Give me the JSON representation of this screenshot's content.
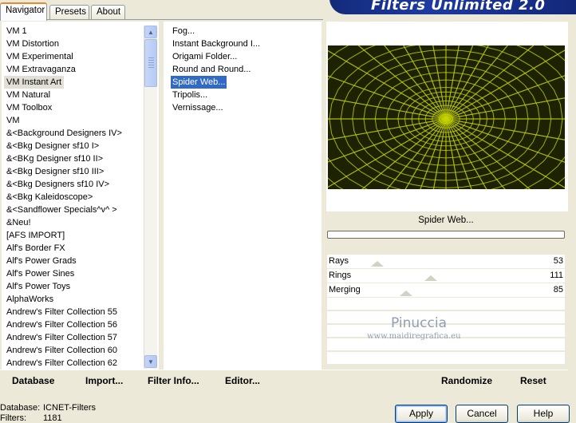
{
  "window_title": "Filters Unlimited 2.0",
  "tabs": [
    "Navigator",
    "Presets",
    "About"
  ],
  "categories": [
    "VM 1",
    "VM Distortion",
    "VM Experimental",
    "VM Extravaganza",
    "VM Instant Art",
    "VM Natural",
    "VM Toolbox",
    "VM",
    "&<Background Designers IV>",
    "&<Bkg Designer sf10 I>",
    "&<BKg Designer sf10 II>",
    "&<Bkg Designer sf10 III>",
    "&<Bkg Designers sf10 IV>",
    "&<Bkg Kaleidoscope>",
    "&<Sandflower Specials^v^ >",
    "&Neu!",
    "[AFS IMPORT]",
    "Alf's Border FX",
    "Alf's Power Grads",
    "Alf's Power Sines",
    "Alf's Power Toys",
    "AlphaWorks",
    "Andrew's Filter Collection 55",
    "Andrew's Filter Collection 56",
    "Andrew's Filter Collection 57",
    "Andrew's Filter Collection 60",
    "Andrew's Filter Collection 62"
  ],
  "selected_category": "VM Instant Art",
  "filters": [
    "Fog...",
    "Instant Background I...",
    "Origami Folder...",
    "Round and Round...",
    "Spider Web...",
    "Tripolis...",
    "Vernissage..."
  ],
  "selected_filter": "Spider Web...",
  "preview": {
    "filter_name": "Spider Web...",
    "colors": {
      "background": "#1d2202",
      "web": "#c8d400"
    }
  },
  "parameters": [
    {
      "label": "Rays",
      "value": "53"
    },
    {
      "label": "Rings",
      "value": "111"
    },
    {
      "label": "Merging",
      "value": "85"
    }
  ],
  "watermark": {
    "name": "Pinuccia",
    "url": "www.maidiregrafica.eu"
  },
  "bottom_buttons": {
    "database": "Database",
    "import": "Import...",
    "filter_info": "Filter Info...",
    "editor": "Editor...",
    "randomize": "Randomize",
    "reset": "Reset"
  },
  "status": {
    "database_label": "Database:",
    "database_value": "ICNET-Filters",
    "filters_label": "Filters:",
    "filters_value": "1181"
  },
  "dialog_buttons": {
    "apply": "Apply",
    "cancel": "Cancel",
    "help": "Help"
  },
  "icons": {
    "scroll_up": "▲",
    "scroll_down": "▼"
  },
  "colors": {
    "accent": "#316ac5",
    "banner": "#1c3aa0",
    "dialog_bg": "#ece9d8"
  }
}
